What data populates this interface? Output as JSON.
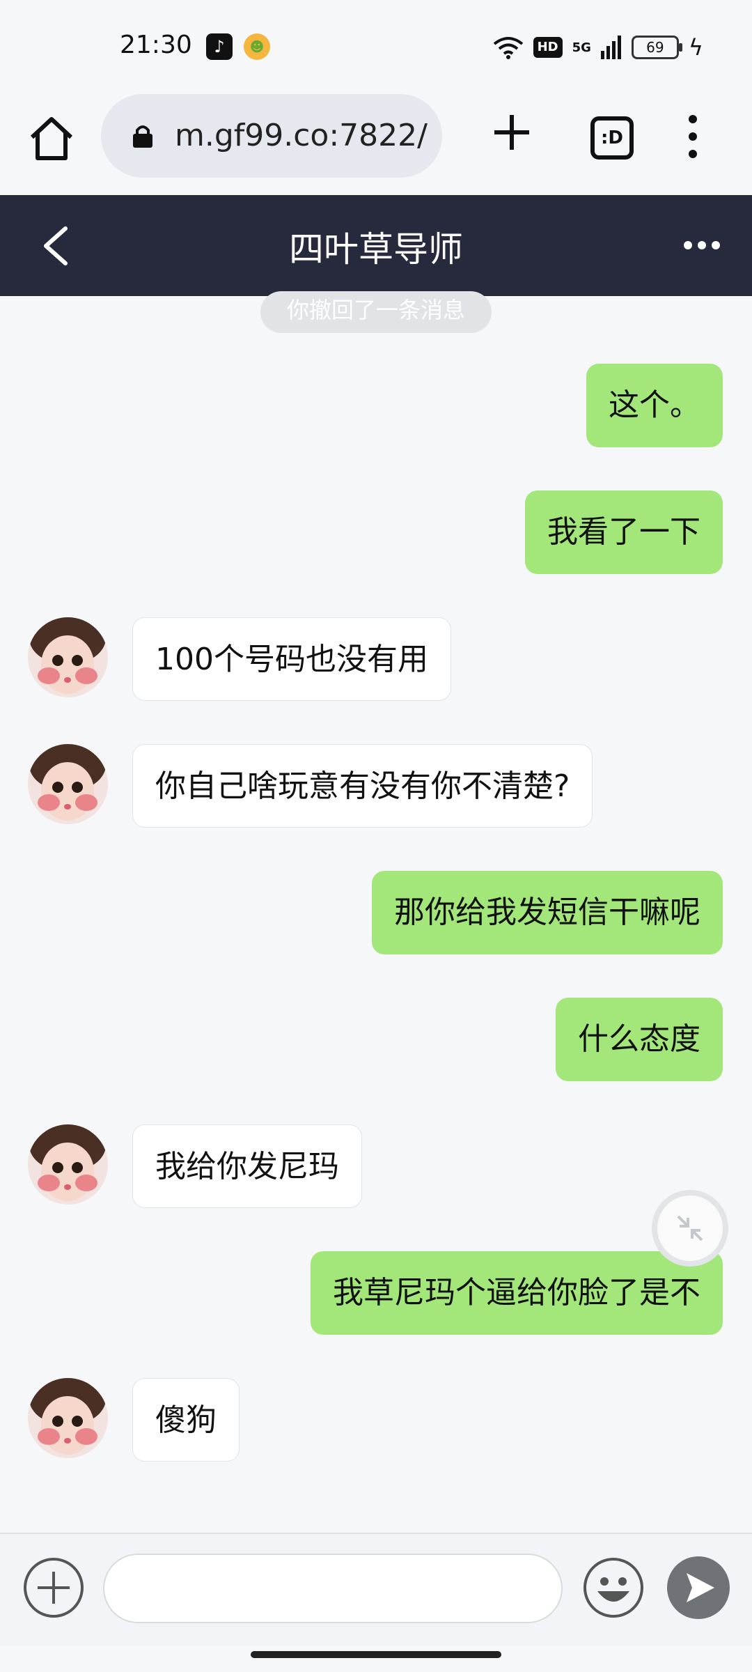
{
  "status_bar": {
    "time": "21:30",
    "network": "5G",
    "hd_badge": "HD",
    "battery": "69"
  },
  "browser": {
    "url": "m.gf99.co:7822/",
    "tabs_label": ":D"
  },
  "chat": {
    "title": "四叶草导师",
    "recall_notice": "你撤回了一条消息",
    "messages": [
      {
        "from": "me",
        "text": "这个。"
      },
      {
        "from": "me",
        "text": "我看了一下"
      },
      {
        "from": "them",
        "text": "100个号码也没有用"
      },
      {
        "from": "them",
        "text": "你自己啥玩意有没有你不清楚?"
      },
      {
        "from": "me",
        "text": "那你给我发短信干嘛呢"
      },
      {
        "from": "me",
        "text": "什么态度"
      },
      {
        "from": "them",
        "text": "我给你发尼玛"
      },
      {
        "from": "me",
        "text": "我草尼玛个逼给你脸了是不"
      },
      {
        "from": "them",
        "text": "傻狗"
      }
    ]
  },
  "input": {
    "value": "",
    "placeholder": ""
  },
  "colors": {
    "header_bg": "#262a3c",
    "my_bubble": "#a3e77a",
    "their_bubble": "#ffffff",
    "send_button": "#6f7378"
  },
  "icons": [
    "home-icon",
    "lock-icon",
    "new-tab-icon",
    "tab-switcher-icon",
    "menu-dots-icon",
    "back-icon",
    "more-icon",
    "avatar",
    "minimize-icon",
    "plus-icon",
    "emoji-icon",
    "send-icon"
  ]
}
